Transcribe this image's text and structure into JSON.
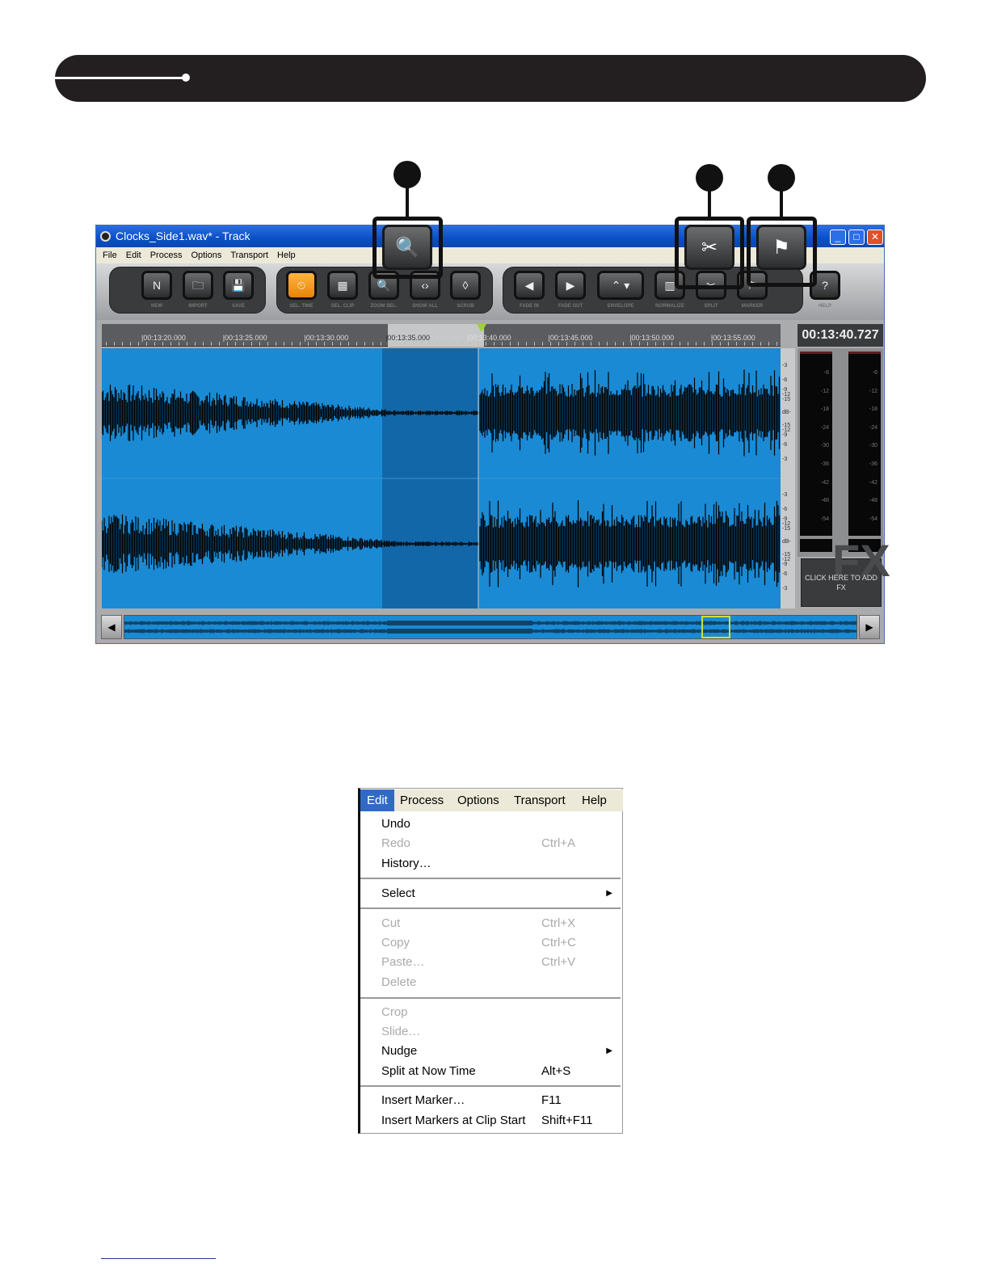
{
  "window": {
    "title": "Clocks_Side1.wav* - Track",
    "menu": [
      "File",
      "Edit",
      "Process",
      "Options",
      "Transport",
      "Help"
    ],
    "controls": [
      "_",
      "□",
      "✕"
    ]
  },
  "toolbar": {
    "buttons": [
      {
        "label": "NEW",
        "icon": "new-file-icon",
        "glyph": "N"
      },
      {
        "label": "IMPORT",
        "icon": "folder-icon",
        "glyph": "🗀"
      },
      {
        "label": "SAVE",
        "icon": "floppy-icon",
        "glyph": "💾"
      },
      {
        "label": "SEL. TIME",
        "icon": "clock-select-icon",
        "glyph": "⏲",
        "active": true
      },
      {
        "label": "SEL. CLIP",
        "icon": "clip-select-icon",
        "glyph": "▦"
      },
      {
        "label": "ZOOM SEL.",
        "icon": "zoom-selection-icon",
        "glyph": "🔍"
      },
      {
        "label": "SHOW ALL",
        "icon": "show-all-icon",
        "glyph": "‹›"
      },
      {
        "label": "SCRUB",
        "icon": "scrub-icon",
        "glyph": "◊"
      },
      {
        "label": "FADE IN",
        "icon": "fade-in-icon",
        "glyph": "◀"
      },
      {
        "label": "FADE OUT",
        "icon": "fade-out-icon",
        "glyph": "▶"
      },
      {
        "label": "ENVELOPE",
        "icon": "envelope-icon",
        "glyph": "⌃ ▾"
      },
      {
        "label": "NORMALIZE",
        "icon": "normalize-icon",
        "glyph": "▥"
      },
      {
        "label": "SPLIT",
        "icon": "scissors-icon",
        "glyph": "✂"
      },
      {
        "label": "MARKER",
        "icon": "marker-flag-icon",
        "glyph": "⚑"
      },
      {
        "label": "HELP",
        "icon": "help-bubble-icon",
        "glyph": "?"
      }
    ]
  },
  "ruler": {
    "labels": [
      "|00:13:20.000",
      "|00:13:25.000",
      "|00:13:30.000",
      "|00:13:35.000",
      "|00:13:40.000",
      "|00:13:45.000",
      "|00:13:50.000",
      "|00:13:55.000"
    ]
  },
  "time_display": "00:13:40.727",
  "db_scale": [
    "-3",
    "-6",
    "-9",
    "-12",
    "-15",
    "dB-",
    "-15",
    "-12",
    "-9",
    "-6",
    "-3"
  ],
  "meter_scale": [
    "-6",
    "-12",
    "-18",
    "-24",
    "-30",
    "-36",
    "-42",
    "-48",
    "-54"
  ],
  "fx": {
    "label": "CLICK HERE TO ADD FX",
    "watermark": "FX"
  },
  "callouts": [
    "zoom-selection",
    "split",
    "marker"
  ],
  "colors": {
    "waveform_bg": "#1a8ad4",
    "selection": "#1267a8",
    "header": "#231f20"
  },
  "edit_menu": {
    "menubar": [
      "Edit",
      "Process",
      "Options",
      "Transport",
      "Help"
    ],
    "items": [
      {
        "label": "Undo",
        "shortcut": "",
        "enabled": true
      },
      {
        "label": "Redo",
        "shortcut": "Ctrl+A",
        "enabled": false
      },
      {
        "label": "History…",
        "shortcut": "",
        "enabled": true
      },
      {
        "label": "Select",
        "shortcut": "",
        "enabled": true,
        "submenu": true
      },
      {
        "label": "Cut",
        "shortcut": "Ctrl+X",
        "enabled": false
      },
      {
        "label": "Copy",
        "shortcut": "Ctrl+C",
        "enabled": false
      },
      {
        "label": "Paste…",
        "shortcut": "Ctrl+V",
        "enabled": false
      },
      {
        "label": "Delete",
        "shortcut": "",
        "enabled": false
      },
      {
        "label": "Crop",
        "shortcut": "",
        "enabled": false
      },
      {
        "label": "Slide…",
        "shortcut": "",
        "enabled": false
      },
      {
        "label": "Nudge",
        "shortcut": "",
        "enabled": true,
        "submenu": true
      },
      {
        "label": "Split at Now Time",
        "shortcut": "Alt+S",
        "enabled": true
      },
      {
        "label": "Insert Marker…",
        "shortcut": "F11",
        "enabled": true
      },
      {
        "label": "Insert Markers at Clip Start",
        "shortcut": "Shift+F11",
        "enabled": true
      }
    ]
  }
}
